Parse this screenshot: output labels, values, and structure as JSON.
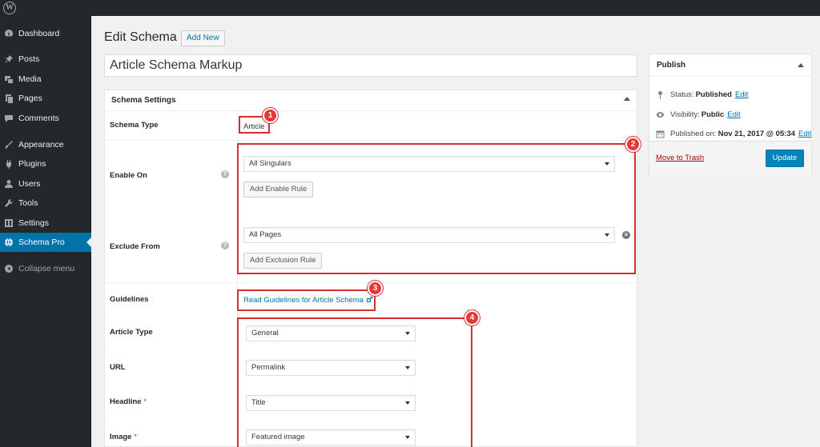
{
  "sidebar": {
    "items": [
      {
        "label": "Dashboard",
        "icon": "dashboard-icon"
      },
      {
        "label": "Posts",
        "icon": "pin-icon"
      },
      {
        "label": "Media",
        "icon": "media-icon"
      },
      {
        "label": "Pages",
        "icon": "pages-icon"
      },
      {
        "label": "Comments",
        "icon": "comments-icon"
      },
      {
        "label": "Appearance",
        "icon": "brush-icon"
      },
      {
        "label": "Plugins",
        "icon": "plug-icon"
      },
      {
        "label": "Users",
        "icon": "user-icon"
      },
      {
        "label": "Tools",
        "icon": "wrench-icon"
      },
      {
        "label": "Settings",
        "icon": "settings-icon"
      },
      {
        "label": "Schema Pro",
        "icon": "globe-icon",
        "active": true
      },
      {
        "label": "Collapse menu",
        "icon": "collapse-icon"
      }
    ]
  },
  "header": {
    "title": "Edit Schema",
    "add_new_label": "Add New"
  },
  "post_title": "Article Schema Markup",
  "schema_settings": {
    "heading": "Schema Settings",
    "schema_type_label": "Schema Type",
    "schema_type_value": "Article",
    "enable_on_label": "Enable On",
    "enable_on_value": "All Singulars",
    "add_enable_rule_label": "Add Enable Rule",
    "exclude_from_label": "Exclude From",
    "exclude_from_value": "All Pages",
    "add_exclusion_rule_label": "Add Exclusion Rule",
    "guidelines_label": "Guidelines",
    "guidelines_link": "Read Guidelines for Article Schema",
    "fields": [
      {
        "label": "Article Type",
        "required": false,
        "value": "General"
      },
      {
        "label": "URL",
        "required": false,
        "value": "Permalink"
      },
      {
        "label": "Headline",
        "required": true,
        "value": "Title"
      },
      {
        "label": "Image",
        "required": true,
        "value": "Featured image"
      }
    ],
    "required_mark": "*",
    "help_mark": "?",
    "remove_mark": "×"
  },
  "annotations": [
    "1",
    "2",
    "3",
    "4"
  ],
  "publish": {
    "heading": "Publish",
    "status_label": "Status:",
    "status_value": "Published",
    "visibility_label": "Visibility:",
    "visibility_value": "Public",
    "published_label": "Published on:",
    "published_value": "Nov 21, 2017 @ 05:34",
    "edit_label": "Edit",
    "trash_label": "Move to Trash",
    "update_label": "Update"
  },
  "colors": {
    "accent": "#0073aa",
    "annotation": "#d32f2f",
    "sidebar_bg": "#23282d"
  }
}
